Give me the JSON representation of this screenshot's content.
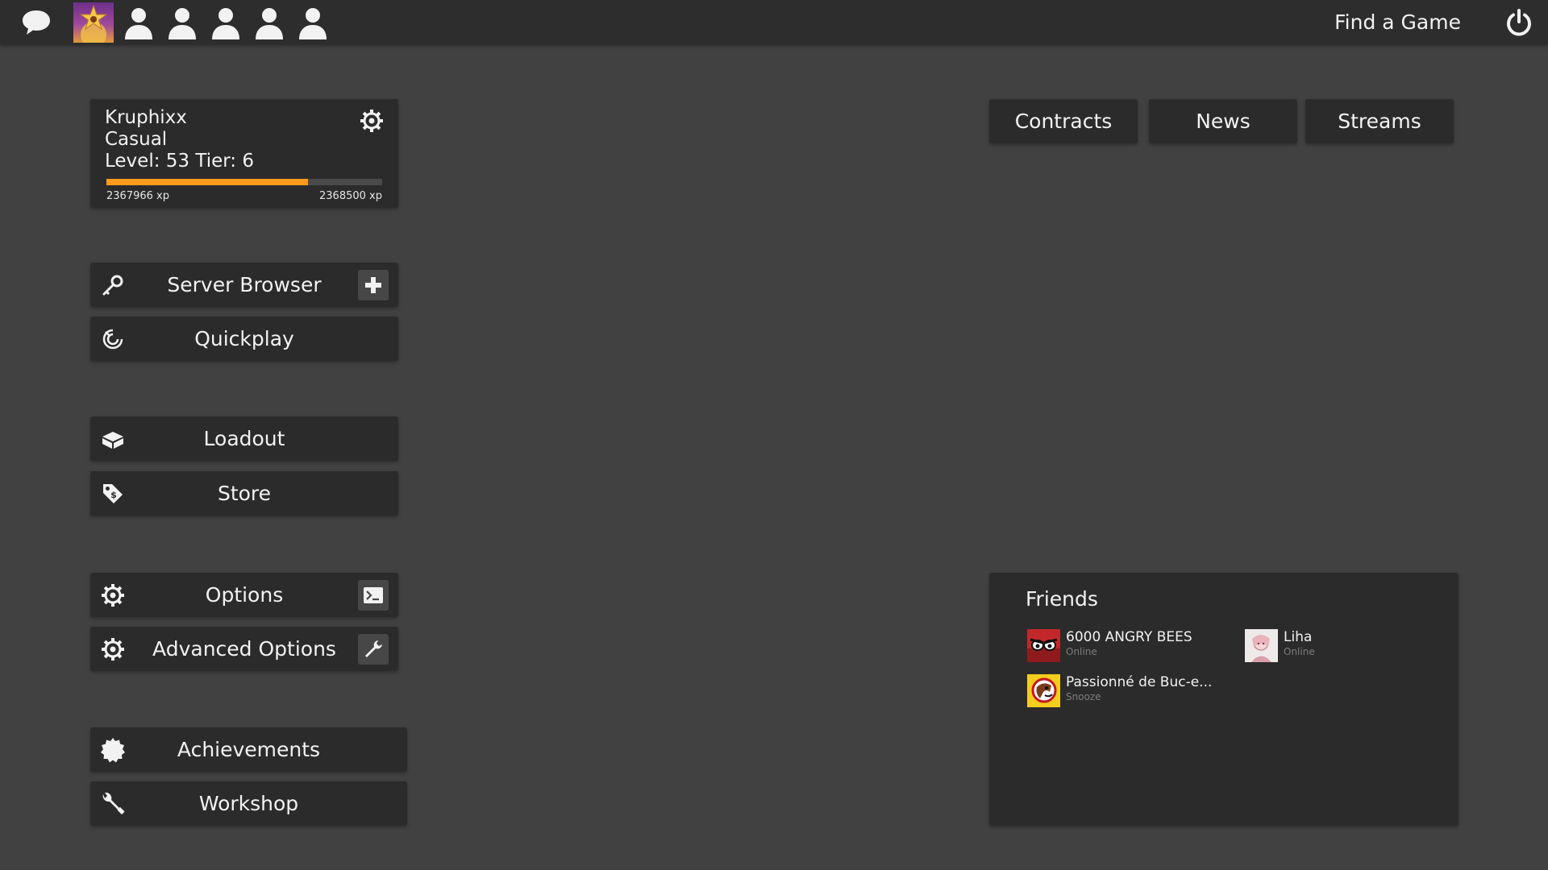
{
  "topbar": {
    "chat_icon": "chat-bubble-icon",
    "party_slots": [
      "person-icon",
      "person-icon",
      "person-icon",
      "person-icon",
      "person-icon"
    ],
    "find_game_label": "Find a Game",
    "power_icon": "power-icon"
  },
  "profile": {
    "name": "Kruphixx",
    "mode": "Casual",
    "level_line": "Level: 53 Tier: 6",
    "xp_current": "2367966 xp",
    "xp_target": "2368500 xp",
    "xp_fraction": 0.73,
    "xp_color": "#ff9a1f"
  },
  "menu": {
    "server_browser": "Server Browser",
    "quickplay": "Quickplay",
    "loadout": "Loadout",
    "store": "Store",
    "options": "Options",
    "advanced_options": "Advanced Options",
    "achievements": "Achievements",
    "workshop": "Workshop"
  },
  "tabs": {
    "contracts": "Contracts",
    "news": "News",
    "streams": "Streams"
  },
  "friends": {
    "title": "Friends",
    "list": [
      {
        "name": "6000 ANGRY BEES",
        "status": "Online"
      },
      {
        "name": "Liha",
        "status": "Online"
      },
      {
        "name": "Passionné de Buc-e...",
        "status": "Snooze"
      }
    ]
  }
}
